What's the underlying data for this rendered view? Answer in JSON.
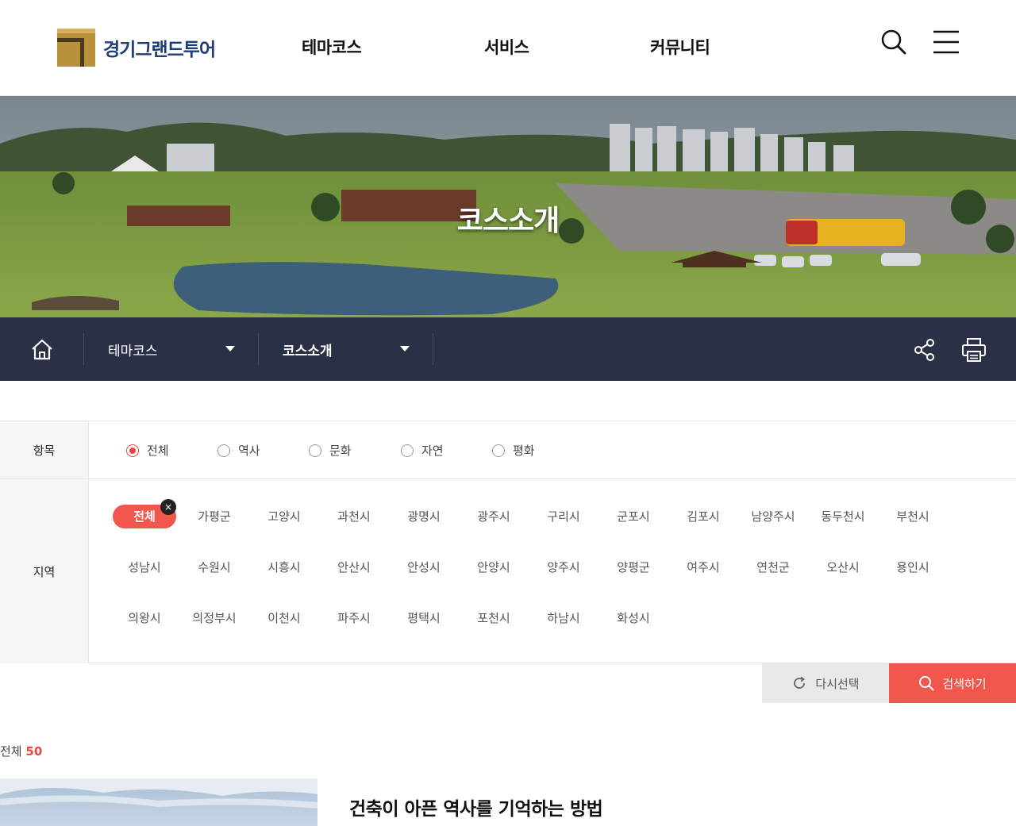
{
  "header": {
    "logo_text": "경기그랜드투어",
    "nav": [
      "테마코스",
      "서비스",
      "커뮤니티"
    ],
    "icons": [
      "search-icon",
      "menu-icon"
    ]
  },
  "hero": {
    "title": "코스소개"
  },
  "location": {
    "home_icon": "home-icon",
    "depth1": "테마코스",
    "depth2": "코스소개",
    "right_icons": [
      "share-icon",
      "print-icon"
    ],
    "bar_color": "#2a3046"
  },
  "filter": {
    "category_label": "항목",
    "categories": [
      "전체",
      "역사",
      "문화",
      "자연",
      "평화"
    ],
    "selected_category": "전체",
    "region_label": "지역",
    "regions": [
      [
        "전체",
        "가평군",
        "고양시",
        "과천시",
        "광명시",
        "광주시",
        "구리시",
        "군포시",
        "김포시",
        "남양주시",
        "동두천시",
        "부천시"
      ],
      [
        "성남시",
        "수원시",
        "시흥시",
        "안산시",
        "안성시",
        "안양시",
        "양주시",
        "양평군",
        "여주시",
        "연천군",
        "오산시",
        "용인시"
      ],
      [
        "의왕시",
        "의정부시",
        "이천시",
        "파주시",
        "평택시",
        "포천시",
        "하남시",
        "화성시"
      ]
    ],
    "selected_region": "전체",
    "remove_glyph": "×"
  },
  "buttons": {
    "reset": "다시선택",
    "search": "검색하기"
  },
  "result": {
    "total_label": "전체",
    "total_count": "50"
  },
  "first_item": {
    "title": "건축이 아픈 역사를 기억하는 방법"
  },
  "colors": {
    "accent": "#f2574e",
    "navy": "#2a3046",
    "logo_gold": "#b8913a",
    "logo_blue": "#1f3d7a"
  }
}
